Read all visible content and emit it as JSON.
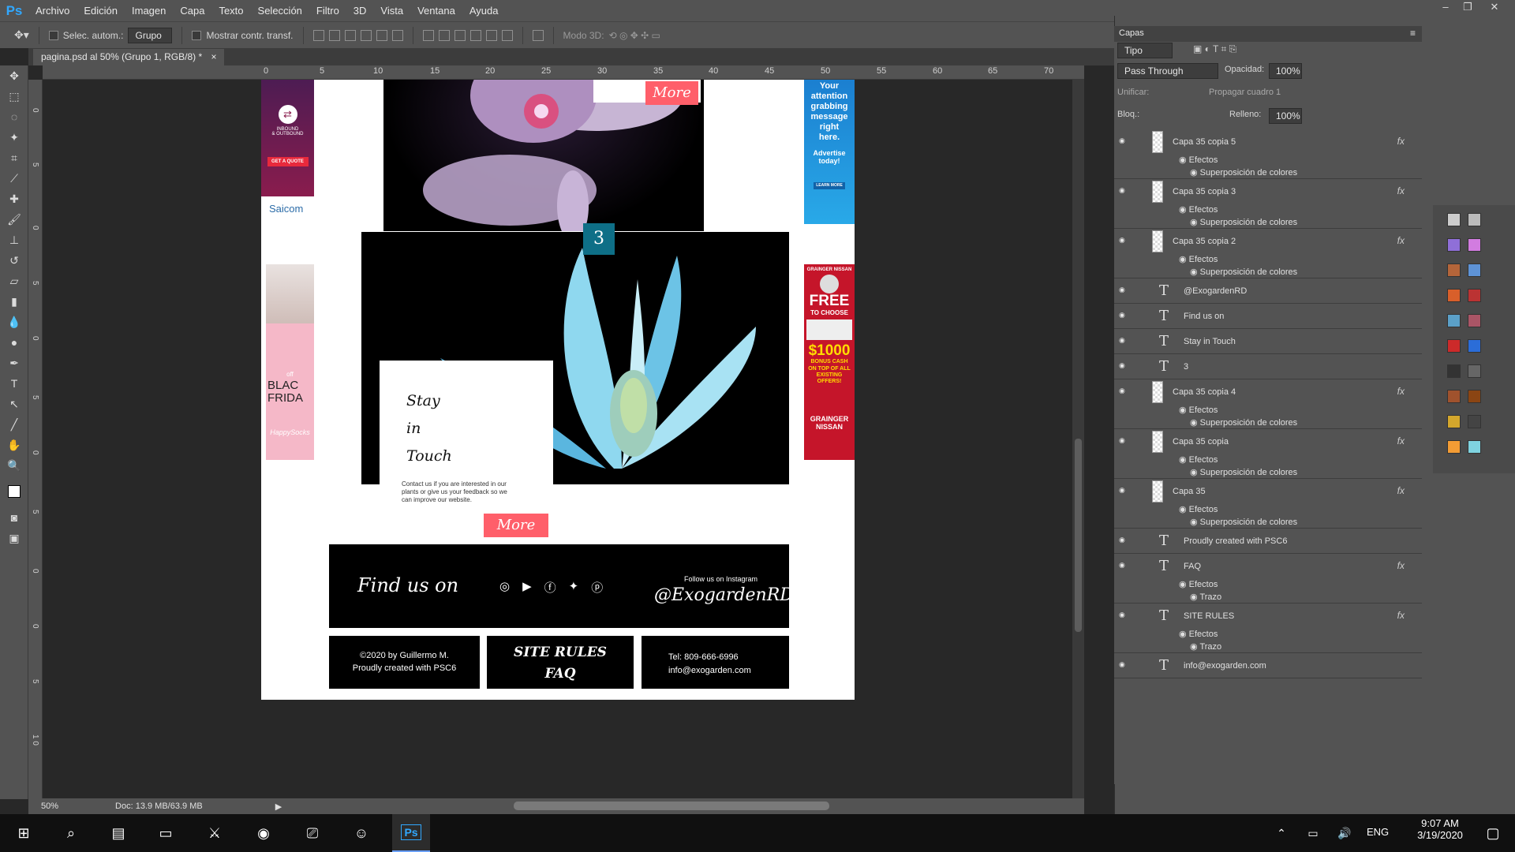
{
  "app": {
    "logo": "Ps",
    "menu": [
      "Archivo",
      "Edición",
      "Imagen",
      "Capa",
      "Texto",
      "Selección",
      "Filtro",
      "3D",
      "Vista",
      "Ventana",
      "Ayuda"
    ]
  },
  "options": {
    "auto_select_label": "Selec. autom.:",
    "auto_select_value": "Grupo",
    "transform_label": "Mostrar contr. transf.",
    "mode3d_label": "Modo 3D:"
  },
  "document": {
    "tab_title": "pagina.psd al 50% (Grupo 1, RGB/8) *",
    "zoom": "50%",
    "doc_size": "Doc: 13.9 MB/63.9 MB",
    "ruler_top": [
      "0",
      "5",
      "10",
      "15",
      "20",
      "25",
      "30",
      "35",
      "40",
      "45",
      "50",
      "55",
      "60",
      "65",
      "70"
    ],
    "ruler_left": [
      "0",
      "5",
      "0",
      "5",
      "0",
      "5",
      "0",
      "5",
      "0",
      "0",
      "5",
      "1 0",
      "1 5",
      "1 0"
    ]
  },
  "page": {
    "more_top": "More",
    "ad1_lines": [
      "INBOUND",
      "& OUTBOUND"
    ],
    "ad1_cta": "GET A QUOTE",
    "ad1_brand": "Saicom",
    "ad2_lines": [
      "Your",
      "attention",
      "grabbing",
      "message",
      "right",
      "here."
    ],
    "ad2_cta": "Advertise today!",
    "ad2_btn": "LEARN MORE",
    "ad3_text": "BLAC FRIDA",
    "ad3_off": "off",
    "ad3_brand": "HappySocks",
    "ad4_top": "GRAINGER NISSAN",
    "ad4_free": "FREE",
    "ad4_choose": "TO CHOOSE",
    "ad4_amount": "$1000",
    "ad4_bonus": "BONUS CASH",
    "ad4_top_of": "ON TOP OF ALL EXISTING OFFERS!",
    "ad4_brand": "GRAINGER NISSAN",
    "number_badge": "3",
    "stay_lines": [
      "Stay",
      "in",
      "Touch"
    ],
    "contact_text": "Contact us if you are interested in our plants or give us your feedback so we can improve our website.",
    "more_bottom": "More",
    "find_us": "Find us on",
    "follow_label": "Follow us on Instagram",
    "handle": "@ExogardenRD",
    "copyright1": "©2020 by Guillermo M.",
    "copyright2": "Proudly created with PSC6",
    "site_rules": "SITE RULES",
    "faq": "FAQ",
    "tel": "Tel: 809-666-6996",
    "email": "info@exogarden.com"
  },
  "panel": {
    "title": "Capas",
    "filter_kind": "Tipo",
    "blend_mode": "Pass Through",
    "opacity_label": "Opacidad:",
    "opacity_value": "100%",
    "unify_label": "Unificar:",
    "propagate_label": "Propagar cuadro 1",
    "lock_label": "Bloq.:",
    "fill_label": "Relleno:",
    "fill_value": "100%",
    "layers": [
      {
        "name": "Capa 35 copia 5",
        "kind": "pixel",
        "fx": true,
        "effects": [
          "Efectos",
          "Superposición de colores"
        ]
      },
      {
        "name": "Capa 35 copia 3",
        "kind": "pixel",
        "fx": true,
        "effects": [
          "Efectos",
          "Superposición de colores"
        ]
      },
      {
        "name": "Capa 35 copia 2",
        "kind": "pixel",
        "fx": true,
        "effects": [
          "Efectos",
          "Superposición de colores"
        ]
      },
      {
        "name": "@ExogardenRD",
        "kind": "text",
        "fx": false,
        "effects": []
      },
      {
        "name": "Find us on",
        "kind": "text",
        "fx": false,
        "effects": []
      },
      {
        "name": "Stay in Touch",
        "kind": "text",
        "fx": false,
        "effects": []
      },
      {
        "name": "3",
        "kind": "text",
        "fx": false,
        "effects": []
      },
      {
        "name": "Capa 35 copia 4",
        "kind": "pixel",
        "fx": true,
        "effects": [
          "Efectos",
          "Superposición de colores"
        ]
      },
      {
        "name": "Capa 35 copia",
        "kind": "pixel",
        "fx": true,
        "effects": [
          "Efectos",
          "Superposición de colores"
        ]
      },
      {
        "name": "Capa 35",
        "kind": "pixel",
        "fx": true,
        "effects": [
          "Efectos",
          "Superposición de colores"
        ]
      },
      {
        "name": "Proudly created with PSC6",
        "kind": "text",
        "fx": false,
        "effects": []
      },
      {
        "name": "FAQ",
        "kind": "text",
        "fx": true,
        "effects": [
          "Efectos",
          "Trazo"
        ]
      },
      {
        "name": "SITE RULES",
        "kind": "text",
        "fx": true,
        "effects": [
          "Efectos",
          "Trazo"
        ]
      },
      {
        "name": "info@exogarden.com",
        "kind": "text",
        "fx": false,
        "effects": []
      }
    ]
  },
  "taskbar": {
    "language": "ENG",
    "time": "9:07 AM",
    "date": "3/19/2020"
  },
  "colors": {
    "accent_more": "#ff5f6a",
    "badge": "#0e6f87",
    "ps_blue": "#31a8ff",
    "ui_panel": "#535353"
  }
}
